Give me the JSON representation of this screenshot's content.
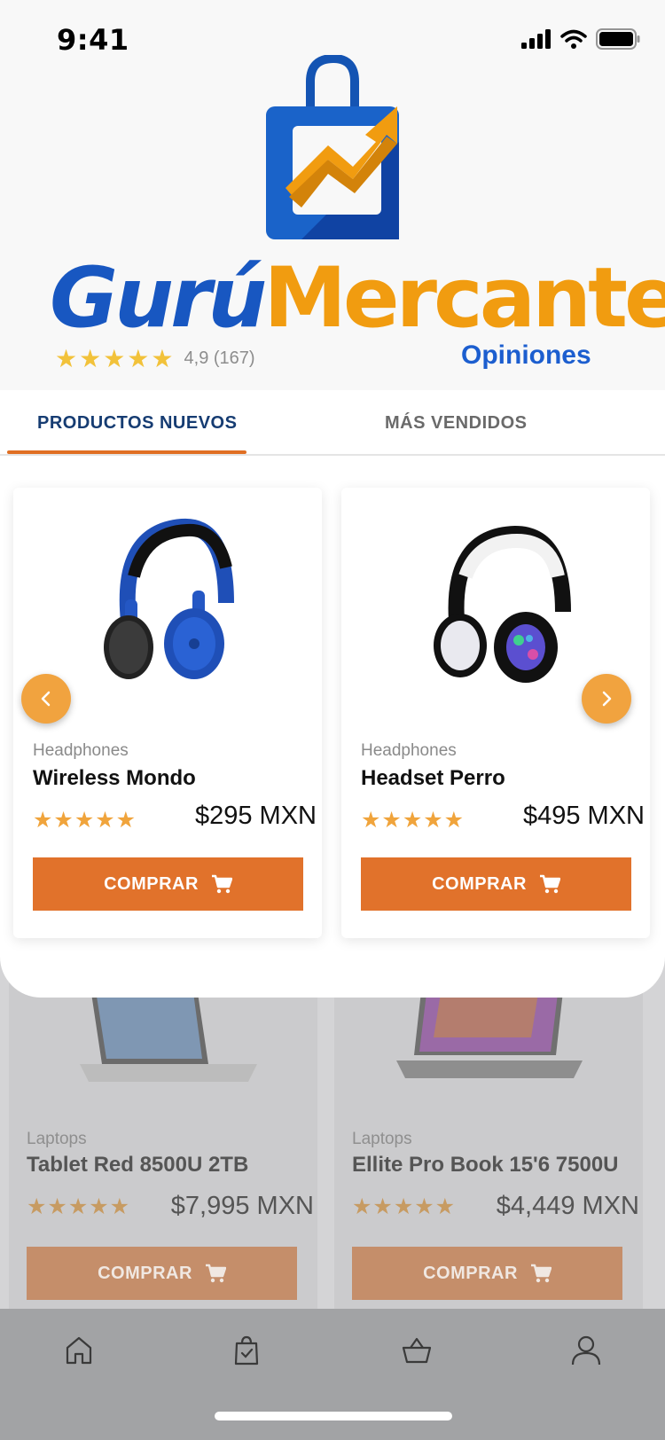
{
  "status_bar": {
    "time": "9:41"
  },
  "header": {
    "brand_part1": "Gurú",
    "brand_part2": "Mercante",
    "rating_stars": "★★★★★",
    "rating_text": "4,9 (167)",
    "opiniones": "Opiniones"
  },
  "tabs": [
    {
      "label": "PRODUCTOS NUEVOS",
      "active": true
    },
    {
      "label": "MÁS VENDIDOS",
      "active": false
    }
  ],
  "products": [
    {
      "category": "Headphones",
      "name": "Wireless Mondo",
      "stars": "★★★★★",
      "price": "$295 MXN",
      "button": "COMPRAR",
      "image": "blue-headphones"
    },
    {
      "category": "Headphones",
      "name": "Headset Perro",
      "stars": "★★★★★",
      "price": "$495 MXN",
      "button": "COMPRAR",
      "image": "white-black-headphones"
    }
  ],
  "products_dimmed": [
    {
      "category": "Laptops",
      "name": "Tablet Red 8500U 2TB",
      "stars": "★★★★★",
      "price": "$7,995 MXN",
      "button": "COMPRAR",
      "image": "silver-laptop"
    },
    {
      "category": "Laptops",
      "name": "Ellite Pro Book 15'6 7500U",
      "stars": "★★★★★",
      "price": "$4,449 MXN",
      "button": "COMPRAR",
      "image": "convertible-laptop"
    }
  ],
  "bottom_nav": [
    "home-icon",
    "shopping-bag-icon",
    "basket-icon",
    "user-icon"
  ],
  "colors": {
    "brand_blue": "#1857c1",
    "brand_orange": "#f19c10",
    "buy_button": "#e1722b",
    "tab_active": "#163c72",
    "arrow": "#f1a33f"
  }
}
